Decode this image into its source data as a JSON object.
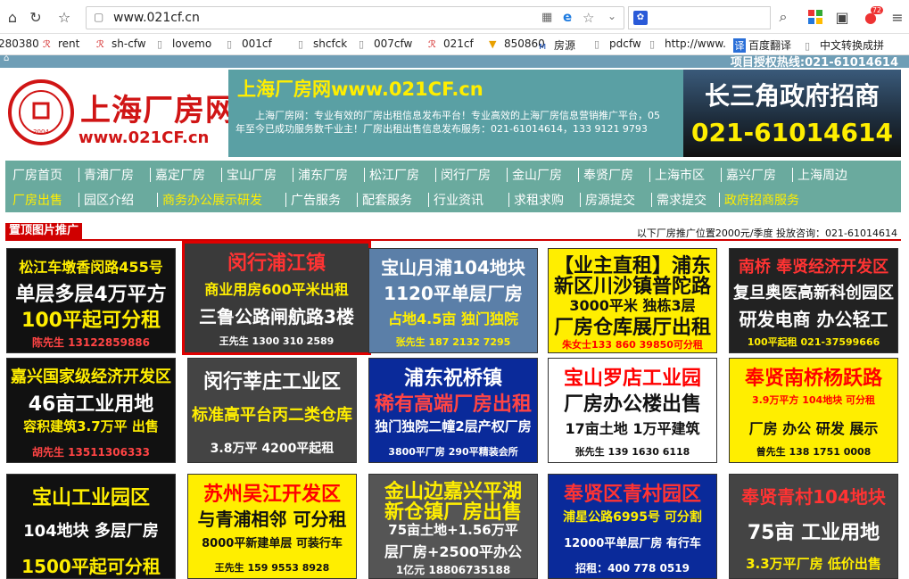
{
  "browser": {
    "url": "www.021cf.cn",
    "badge_count": "72"
  },
  "bookmarks": [
    {
      "label": "280380",
      "icon": "doc"
    },
    {
      "label": "rent",
      "icon": "r"
    },
    {
      "label": "sh-cfw",
      "icon": "r"
    },
    {
      "label": "lovemo",
      "icon": "doc"
    },
    {
      "label": "001cf",
      "icon": "doc"
    },
    {
      "label": "shcfck",
      "icon": "doc"
    },
    {
      "label": "007cfw",
      "icon": "doc"
    },
    {
      "label": "021cf",
      "icon": "r"
    },
    {
      "label": "850860",
      "icon": "cup"
    },
    {
      "label": "房源",
      "icon": "m"
    },
    {
      "label": "pdcfw",
      "icon": "doc"
    },
    {
      "label": "http://www.",
      "icon": "doc"
    },
    {
      "label": "百度翻译",
      "icon": "translate"
    },
    {
      "label": "中文转换成拼",
      "icon": "doc"
    }
  ],
  "site": {
    "top_hotline": "项目授权热线:021-61014614",
    "logo_name": "上海厂房网",
    "logo_url": "www.021CF.cn",
    "logo_seal": "上海正佳商务 2004 ZHENGJIA",
    "banner_title": "上海厂房网www.021CF.cn",
    "banner_desc": "上海厂房网：专业有效的厂房出租信息发布平台！专业高效的上海厂房信息营销推广平台，05年至今已成功服务数千业主！厂房出租出售信息发布服务：021-61014614，133 9121 9793",
    "promo_title": "长三角政府招商",
    "promo_phone": "021-61014614"
  },
  "nav": {
    "row1": [
      "厂房首页",
      "青浦厂房",
      "嘉定厂房",
      "宝山厂房",
      "浦东厂房",
      "松江厂房",
      "闵行厂房",
      "金山厂房",
      "奉贤厂房",
      "上海市区",
      "嘉兴厂房",
      "上海周边"
    ],
    "row2": [
      "厂房出售",
      "园区介绍",
      "商务办公展示研发",
      "广告服务",
      "配套服务",
      "行业资讯",
      "求租求购",
      "房源提交",
      "需求提交",
      "政府招商服务"
    ]
  },
  "section": {
    "title": "置顶图片推广",
    "note": "以下厂房推广位置2000元/季度 投放咨询：021-61014614"
  },
  "ads": [
    {
      "lines": [
        "松江车墩香闵路455号",
        "单层多层4万平方",
        "100平起可分租",
        "陈先生 13122859886"
      ],
      "bg": "#111111",
      "colors": [
        "#ffee00",
        "#ffffff",
        "#ffee00",
        "#ff4444"
      ]
    },
    {
      "lines": [
        "闵行浦江镇",
        "商业用房600平米出租",
        "三鲁公路闸航路3楼",
        "王先生 1300 310 2589"
      ],
      "bg": "#3a3a3a",
      "colors": [
        "#ff3333",
        "#ffee00",
        "#ffffff",
        "#ffffff"
      ]
    },
    {
      "lines": [
        "宝山月浦104地块",
        "1120平单层厂房",
        "占地4.5亩 独门独院",
        "张先生 187 2132 7295"
      ],
      "bg": "#5b7fa8",
      "colors": [
        "#ffffff",
        "#ffffff",
        "#ffee00",
        "#ffee00"
      ]
    },
    {
      "lines": [
        "【业主直租】浦东",
        "新区川沙镇普陀路",
        "3000平米 独栋3层",
        "厂房仓库展厅出租",
        "朱女士133 860 39850可分租"
      ],
      "bg": "#ffee00",
      "colors": [
        "#111111",
        "#111111",
        "#111111",
        "#111111",
        "#ff0000"
      ]
    },
    {
      "lines": [
        "南桥 奉贤经济开发区",
        "复旦奥医高新科创园区",
        "研发电商 办公轻工",
        "100平起租 021-37599666"
      ],
      "bg": "#222222",
      "colors": [
        "#ff3333",
        "#ffffff",
        "#ffffff",
        "#ffee00"
      ]
    },
    {
      "lines": [
        "嘉兴国家级经济开发区",
        "46亩工业用地",
        "容积建筑3.7万平 出售",
        "胡先生 13511306333"
      ],
      "bg": "#111111",
      "colors": [
        "#ffee00",
        "#ffffff",
        "#ffee00",
        "#ff4444"
      ]
    },
    {
      "lines": [
        "闵行莘庄工业区",
        "标准高平台丙二类仓库",
        "3.8万平 4200平起租"
      ],
      "bg": "#444444",
      "colors": [
        "#ffffff",
        "#ffee00",
        "#ffffff"
      ]
    },
    {
      "lines": [
        "浦东祝桥镇",
        "稀有高端厂房出租",
        "独门独院二幢2层产权厂房",
        "3800平厂房 290平精装会所"
      ],
      "bg": "#0a2a9a",
      "colors": [
        "#ffffff",
        "#ff4444",
        "#ffffff",
        "#ffffff"
      ]
    },
    {
      "lines": [
        "宝山罗店工业园",
        "厂房办公楼出售",
        "17亩土地 1万平建筑",
        "张先生 139 1630 6118"
      ],
      "bg": "#ffffff",
      "colors": [
        "#ff0000",
        "#111111",
        "#111111",
        "#111111"
      ]
    },
    {
      "lines": [
        "奉贤南桥杨跃路",
        "3.9万平方 104地块 可分租",
        "厂房 办公 研发 展示",
        "曾先生 138 1751 0008"
      ],
      "bg": "#ffee00",
      "colors": [
        "#ff0000",
        "#ff0000",
        "#111111",
        "#111111"
      ]
    },
    {
      "lines": [
        "宝山工业园区",
        "104地块 多层厂房",
        "1500平起可分租"
      ],
      "bg": "#111111",
      "colors": [
        "#ffee00",
        "#ffffff",
        "#ffee00"
      ]
    },
    {
      "lines": [
        "苏州吴江开发区",
        "与青浦相邻 可分租",
        "8000平新建单层 可装行车",
        "王先生 159 9553 8928"
      ],
      "bg": "#ffee00",
      "colors": [
        "#ff0000",
        "#111111",
        "#111111",
        "#111111"
      ]
    },
    {
      "lines": [
        "金山边嘉兴平湖",
        "新仓镇厂房出售",
        "75亩土地+1.56万平",
        "层厂房+2500平办公",
        "1亿元 18806735188"
      ],
      "bg": "#555555",
      "colors": [
        "#ffee00",
        "#ffee00",
        "#ffffff",
        "#ffffff",
        "#ffffff"
      ]
    },
    {
      "lines": [
        "奉贤区青村园区",
        "浦星公路6995号 可分割",
        "12000平单层厂房 有行车",
        "招租：400 778 0519"
      ],
      "bg": "#0a2a9a",
      "colors": [
        "#ff3333",
        "#ffee00",
        "#ffffff",
        "#ffffff"
      ]
    },
    {
      "lines": [
        "奉贤青村104地块",
        "75亩 工业用地",
        "3.3万平厂房 低价出售"
      ],
      "bg": "#444444",
      "colors": [
        "#ff3333",
        "#ffffff",
        "#ffee00"
      ]
    }
  ]
}
